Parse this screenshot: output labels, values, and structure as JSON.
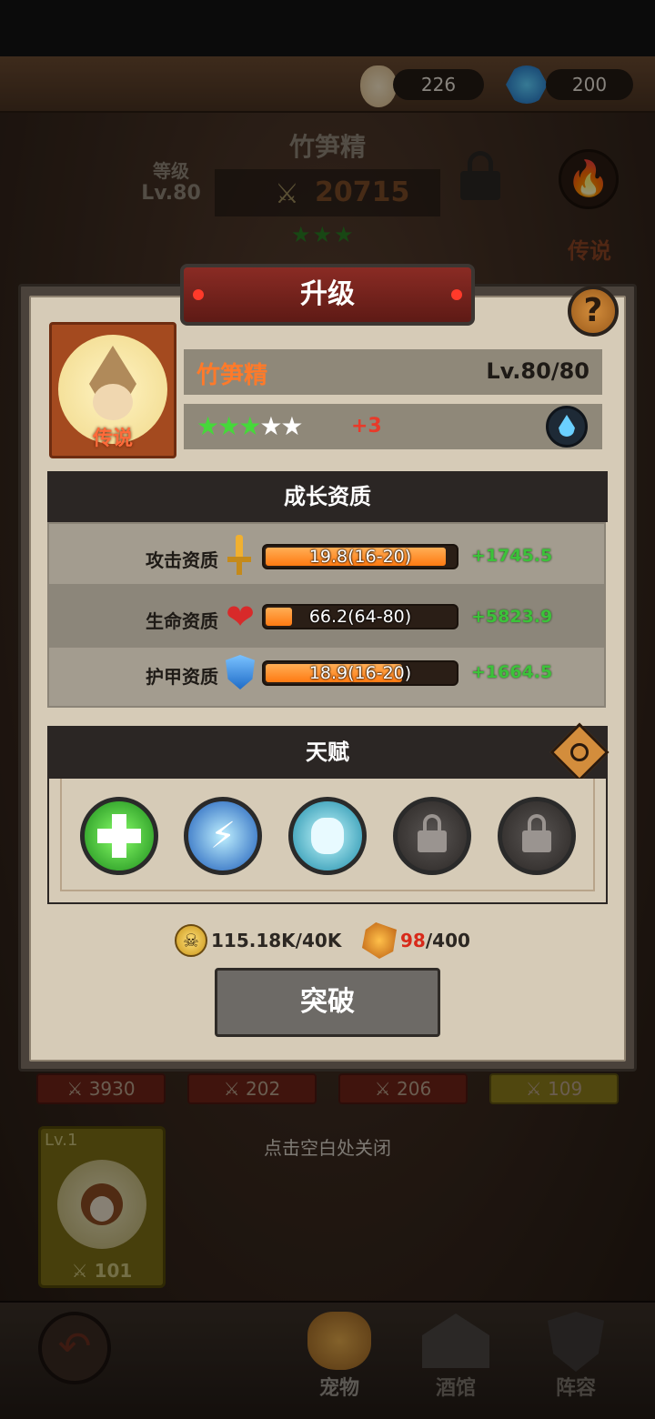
{
  "currency": {
    "eggs": "226",
    "gems": "200"
  },
  "hero": {
    "name": "竹笋精",
    "level_label": "等级",
    "level": "Lv.80",
    "power": "20715",
    "quality": "传说"
  },
  "modal": {
    "title": "升级",
    "help": "?",
    "pet_name": "竹笋精",
    "pet_quality": "传说",
    "level": "Lv.80/80",
    "star_bonus": "+3",
    "growth_title": "成长资质",
    "stats": [
      {
        "label": "攻击资质",
        "value": "19.8(16-20)",
        "bonus": "+1745.5",
        "fill": 0.95
      },
      {
        "label": "生命资质",
        "value": "66.2(64-80)",
        "bonus": "+5823.9",
        "fill": 0.14
      },
      {
        "label": "护甲资质",
        "value": "18.9(16-20)",
        "bonus": "+1664.5",
        "fill": 0.72
      }
    ],
    "talent_title": "天赋",
    "talents": [
      "heal-talent-icon",
      "lightning-blade-talent-icon",
      "stone-guardian-talent-icon",
      "lock-icon",
      "lock-icon"
    ],
    "gold_cost": "115.18K/40K",
    "crystal_have": "98",
    "crystal_need": "/400",
    "breakthrough_label": "突破"
  },
  "background": {
    "stat_tags": [
      "3930",
      "202",
      "206",
      "109"
    ],
    "pet_card": {
      "level": "Lv.1",
      "power": "101"
    },
    "close_hint": "点击空白处关闭"
  },
  "bottom_nav": {
    "pets": "宠物",
    "tavern": "酒馆",
    "lineup": "阵容"
  },
  "colors": {
    "accent_orange": "#ff7a2a",
    "bonus_green": "#3cc23a",
    "title_red": "#8a2b24"
  }
}
